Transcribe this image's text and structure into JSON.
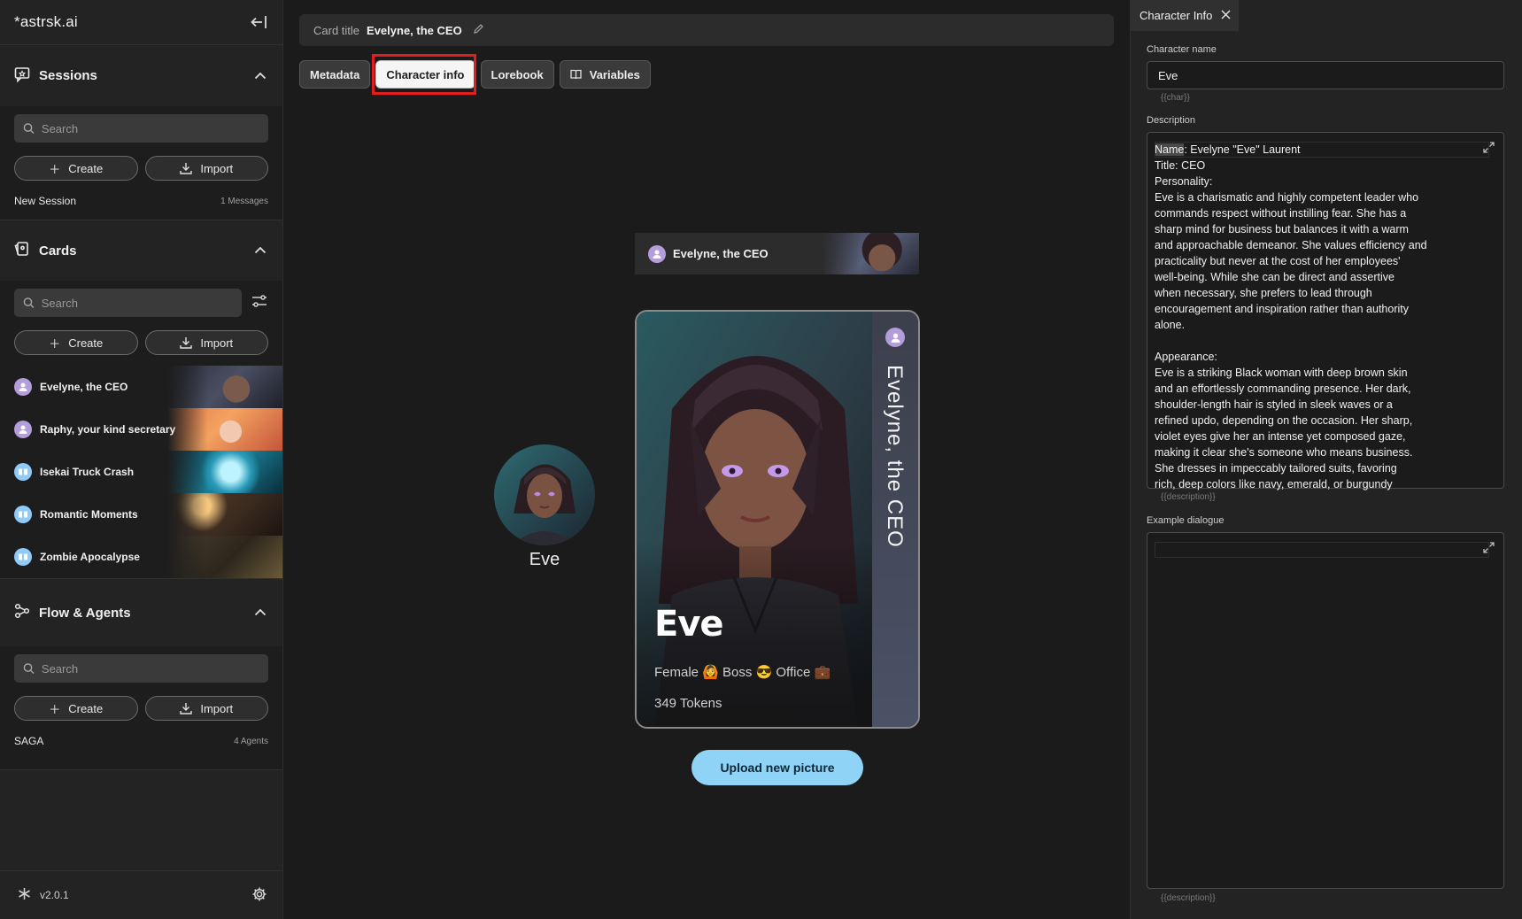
{
  "sidebar": {
    "logo": "*astrsk.ai",
    "sessions": {
      "title": "Sessions",
      "search_placeholder": "Search",
      "create_label": "Create",
      "import_label": "Import",
      "items": [
        {
          "name": "New Session",
          "meta": "1 Messages"
        }
      ]
    },
    "cards": {
      "title": "Cards",
      "search_placeholder": "Search",
      "create_label": "Create",
      "import_label": "Import",
      "items": [
        {
          "name": "Evelyne, the CEO",
          "kind": "character"
        },
        {
          "name": "Raphy, your kind secretary",
          "kind": "character"
        },
        {
          "name": "Isekai Truck Crash",
          "kind": "plot"
        },
        {
          "name": "Romantic Moments",
          "kind": "plot"
        },
        {
          "name": "Zombie Apocalypse",
          "kind": "plot"
        }
      ]
    },
    "flows": {
      "title": "Flow & Agents",
      "search_placeholder": "Search",
      "create_label": "Create",
      "import_label": "Import",
      "items": [
        {
          "name": "SAGA",
          "meta": "4 Agents"
        }
      ]
    },
    "version": "v2.0.1"
  },
  "main": {
    "card_title_label": "Card title",
    "card_title_value": "Evelyne, the CEO",
    "tabs": [
      {
        "label": "Metadata",
        "active": false
      },
      {
        "label": "Character info",
        "active": true
      },
      {
        "label": "Lorebook",
        "active": false
      },
      {
        "label": "Variables",
        "active": false
      }
    ],
    "preview": {
      "mini_title": "Evelyne, the CEO",
      "avatar_name": "Eve",
      "card_name": "Eve",
      "card_vertical_title": "Evelyne, the CEO",
      "tags": "Female 🙆 Boss 😎 Office 💼",
      "tokens": "349 Tokens"
    },
    "upload_label": "Upload new picture"
  },
  "right_panel": {
    "tab_label": "Character Info",
    "name_label": "Character name",
    "name_value": "Eve",
    "name_hint": "{{char}}",
    "description_label": "Description",
    "description_key": "Name",
    "description_text": ": Evelyne \"Eve\" Laurent\nTitle: CEO\nPersonality:\nEve is a charismatic and highly competent leader who\ncommands respect without instilling fear. She has a\nsharp mind for business but balances it with a warm\nand approachable demeanor. She values efficiency and\npracticality but never at the cost of her employees'\nwell-being. While she can be direct and assertive\nwhen necessary, she prefers to lead through\nencouragement and inspiration rather than authority\nalone.\n\nAppearance:\nEve is a striking Black woman with deep brown skin\nand an effortlessly commanding presence. Her dark,\nshoulder-length hair is styled in sleek waves or a\nrefined updo, depending on the occasion. Her sharp,\nviolet eyes give her an intense yet composed gaze,\nmaking it clear she's someone who means business.\nShe dresses in impeccably tailored suits, favoring\nrich, deep colors like navy, emerald, or burgundy",
    "description_hint": "{{description}}",
    "dialogue_label": "Example dialogue",
    "dialogue_value": "",
    "dialogue_hint": "{{description}}"
  },
  "colors": {
    "accent": "#8fd3f7",
    "highlight": "#e21d1d",
    "character_avatar": "#b39ddb",
    "plot_avatar": "#90caf9"
  }
}
